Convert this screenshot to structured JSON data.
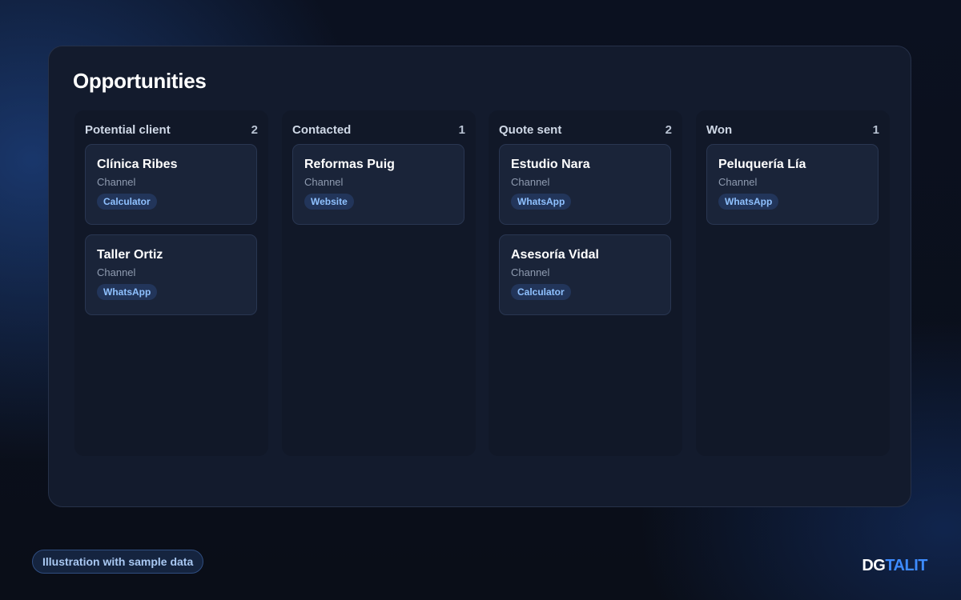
{
  "board": {
    "title": "Opportunities",
    "columns": [
      {
        "name": "Potential client",
        "count": "2",
        "cards": [
          {
            "name": "Clínica Ribes",
            "label": "Channel",
            "channel": "Calculator"
          },
          {
            "name": "Taller Ortiz",
            "label": "Channel",
            "channel": "WhatsApp"
          }
        ]
      },
      {
        "name": "Contacted",
        "count": "1",
        "cards": [
          {
            "name": "Reformas Puig",
            "label": "Channel",
            "channel": "Website"
          }
        ]
      },
      {
        "name": "Quote sent",
        "count": "2",
        "cards": [
          {
            "name": "Estudio Nara",
            "label": "Channel",
            "channel": "WhatsApp"
          },
          {
            "name": "Asesoría Vidal",
            "label": "Channel",
            "channel": "Calculator"
          }
        ]
      },
      {
        "name": "Won",
        "count": "1",
        "cards": [
          {
            "name": "Peluquería Lía",
            "label": "Channel",
            "channel": "WhatsApp"
          }
        ]
      }
    ]
  },
  "footer": {
    "note": "Illustration with sample data",
    "logo_part1": "DG",
    "logo_part2": "TALIT"
  },
  "colors": {
    "accent": "#3d8bff",
    "badge_text": "#8fc1ff",
    "badge_bg": "#22355a"
  }
}
